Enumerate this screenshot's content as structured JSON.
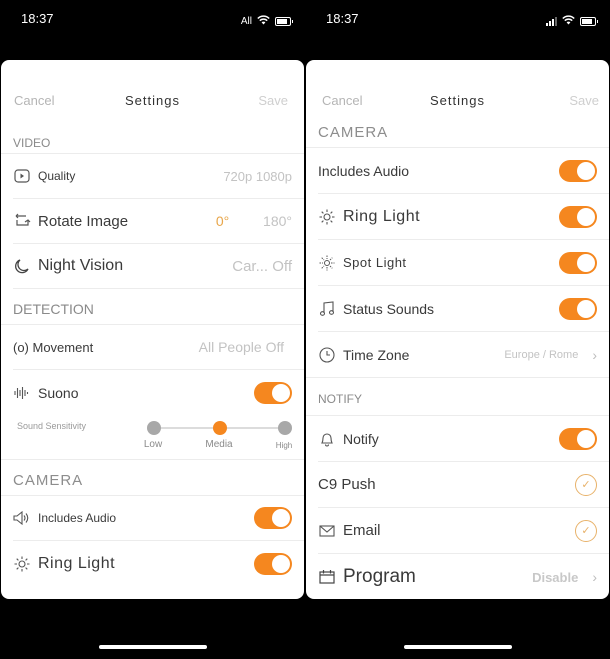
{
  "left": {
    "status": {
      "time": "18:37",
      "carrier": "All"
    },
    "nav": {
      "cancel": "Cancel",
      "title": "Settings",
      "save": "Save"
    },
    "video": {
      "header": "VIDEO",
      "quality": {
        "label": "Quality",
        "value": "720p 1080p"
      },
      "rotate": {
        "label": "Rotate Image",
        "option_a": "0°",
        "option_b": "180°"
      },
      "night": {
        "label": "Night Vision",
        "value": "Car... Off"
      }
    },
    "detection": {
      "header": "DETECTION",
      "movement": {
        "label": "(o) Movement",
        "value": "All People Off"
      },
      "sound": {
        "label": "Suono",
        "enabled": true
      },
      "sensitivity": {
        "label": "Sound Sensitivity",
        "options": [
          "Low",
          "Media",
          "High"
        ],
        "selected": "Media"
      }
    },
    "camera": {
      "header": "CAMERA",
      "audio": {
        "label": "Includes Audio",
        "enabled": true
      },
      "ring": {
        "label": "Ring Light",
        "enabled": true
      }
    }
  },
  "right": {
    "status": {
      "time": "18:37"
    },
    "nav": {
      "cancel": "Cancel",
      "title": "Settings",
      "save": "Save"
    },
    "camera": {
      "header": "CAMERA",
      "audio": {
        "label": "Includes Audio",
        "enabled": true
      },
      "ring": {
        "label": "Ring Light",
        "enabled": true
      },
      "spot": {
        "label": "Spot Light",
        "enabled": true
      },
      "status_sounds": {
        "label": "Status Sounds",
        "enabled": true
      },
      "timezone": {
        "label": "Time Zone",
        "value": "Europe / Rome"
      }
    },
    "notify": {
      "header": "NOTIFY",
      "notify": {
        "label": "Notify",
        "enabled": true
      },
      "push": {
        "label": "C9 Push",
        "checked": true
      },
      "email": {
        "label": "Email",
        "checked": true
      },
      "program": {
        "label": "Program",
        "value": "Disable"
      }
    }
  },
  "colors": {
    "accent": "#f5871f",
    "check": "#e8b26a"
  }
}
